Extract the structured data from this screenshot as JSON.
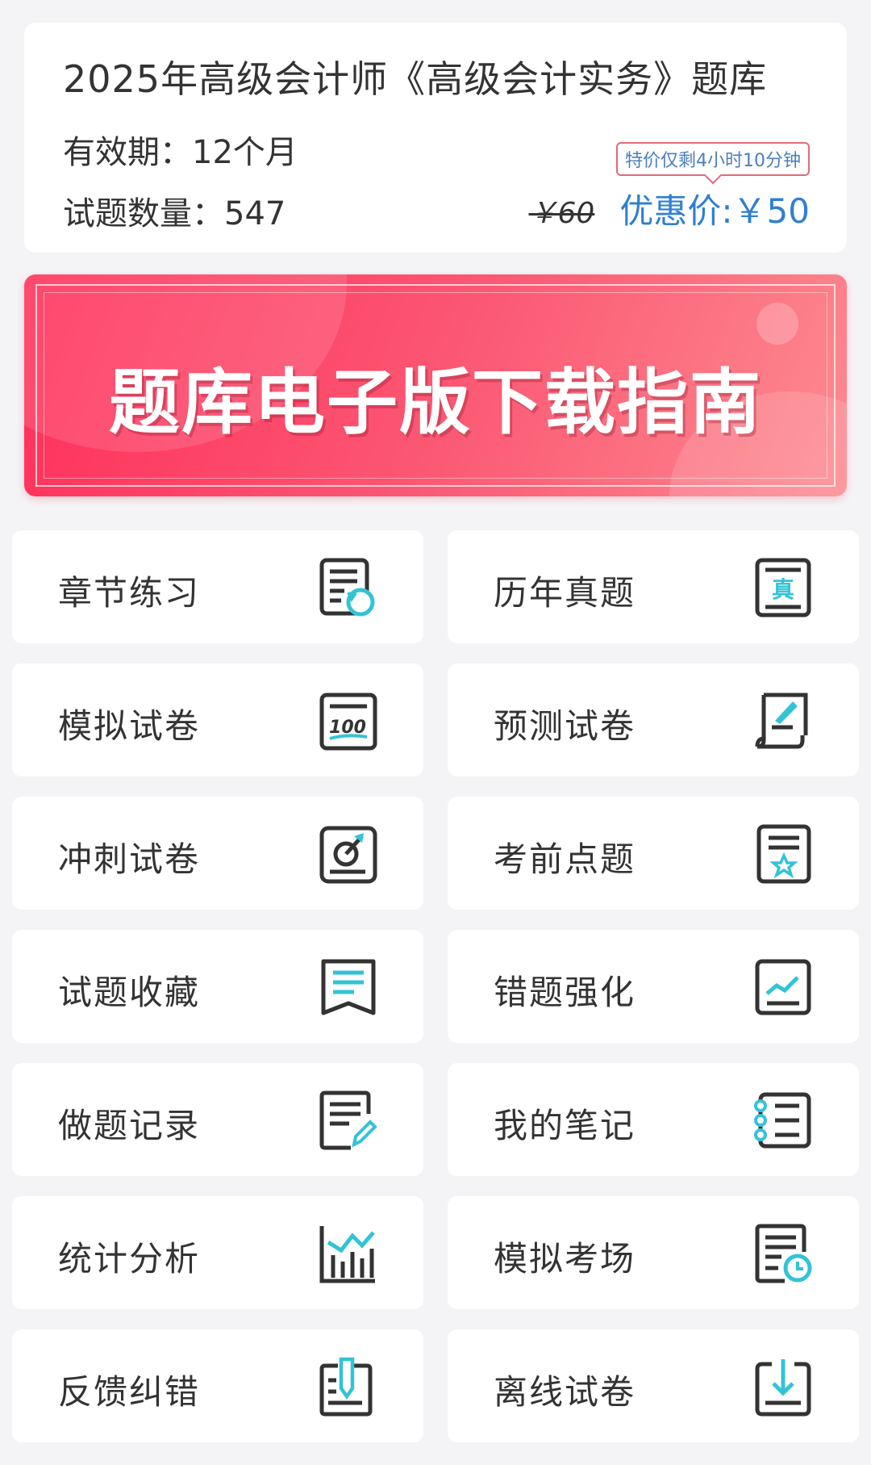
{
  "product": {
    "title": "2025年高级会计师《高级会计实务》题库",
    "validity": "有效期：12个月",
    "question_count": "试题数量：547",
    "countdown": "特价仅剩4小时10分钟",
    "original_price": "￥60",
    "discount_price": "优惠价:￥50"
  },
  "banner": {
    "text": "题库电子版下载指南"
  },
  "menu": [
    {
      "label": "章节练习",
      "icon": "chapter-practice-icon"
    },
    {
      "label": "历年真题",
      "icon": "past-exams-icon"
    },
    {
      "label": "模拟试卷",
      "icon": "mock-paper-icon"
    },
    {
      "label": "预测试卷",
      "icon": "prediction-paper-icon"
    },
    {
      "label": "冲刺试卷",
      "icon": "sprint-paper-icon"
    },
    {
      "label": "考前点题",
      "icon": "pre-exam-star-icon"
    },
    {
      "label": "试题收藏",
      "icon": "bookmark-icon"
    },
    {
      "label": "错题强化",
      "icon": "wrong-question-chart-icon"
    },
    {
      "label": "做题记录",
      "icon": "record-edit-icon"
    },
    {
      "label": "我的笔记",
      "icon": "notebook-icon"
    },
    {
      "label": "统计分析",
      "icon": "bar-chart-icon"
    },
    {
      "label": "模拟考场",
      "icon": "exam-clock-icon"
    },
    {
      "label": "反馈纠错",
      "icon": "feedback-pen-icon"
    },
    {
      "label": "离线试卷",
      "icon": "download-icon"
    }
  ],
  "colors": {
    "accent": "#2f7fd1",
    "icon_dark": "#333333",
    "icon_teal": "#33c3d6",
    "banner_red": "#ff2f5a"
  }
}
